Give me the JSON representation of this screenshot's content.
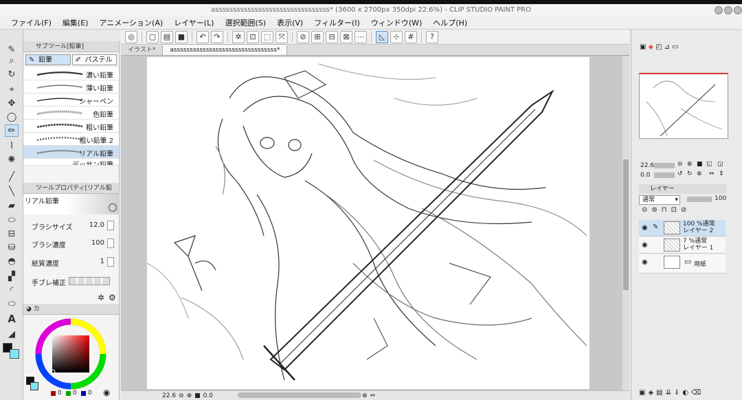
{
  "window": {
    "title": "assssssssssssssssssssssssssssssss* (3600 x 2700px 350dpi 22.6%)  - CLIP STUDIO PAINT PRO"
  },
  "menu": [
    "ファイル(F)",
    "編集(E)",
    "アニメーション(A)",
    "レイヤー(L)",
    "選択範囲(S)",
    "表示(V)",
    "フィルター(I)",
    "ウィンドウ(W)",
    "ヘルプ(H)"
  ],
  "subtool": {
    "header": "サブツール[鉛筆]",
    "tabs": [
      "鉛筆",
      "パステル"
    ],
    "brushes": [
      "濃い鉛筆",
      "薄い鉛筆",
      "シャーペン",
      "色鉛筆",
      "粗い鉛筆",
      "粗い鉛筆 2",
      "リアル鉛筆",
      "デッサン鉛筆"
    ],
    "selected_index": 6
  },
  "tool_property": {
    "header": "ツールプロパティ[リアル鉛",
    "tool_name": "リアル鉛筆",
    "brush_size_label": "ブラシサイズ",
    "brush_size_value": "12.0",
    "brush_density_label": "ブラシ濃度",
    "brush_density_value": "100",
    "paper_texture_label": "紙質濃度",
    "paper_texture_value": "1",
    "stabilization_label": "手ブレ補正"
  },
  "color": {
    "tab_label": "カ",
    "main_color": "#111111",
    "sub_color": "#7fe8f5",
    "accent": "#d33333",
    "rgb_values": [
      "0",
      "0",
      "0"
    ]
  },
  "document": {
    "tabs": [
      "イラスト*",
      "assssssssssssssssssssssssssssssss*"
    ]
  },
  "status": {
    "zoom": "22.6",
    "rotation": "0.0"
  },
  "navigator": {
    "zoom": "22.6",
    "angle": "0.0"
  },
  "layers": {
    "tab_label": "レイヤー",
    "blend_mode": "通常",
    "opacity": "100",
    "rows": [
      {
        "line1": "100 %通常",
        "line2": "レイヤー 2"
      },
      {
        "line1": "7 %通常",
        "line2": "レイヤー 1"
      },
      {
        "line1": "",
        "line2": "用紙"
      }
    ]
  }
}
